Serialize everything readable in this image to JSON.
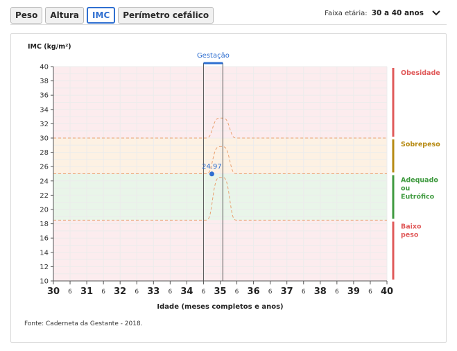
{
  "tabs": [
    {
      "label": "Peso",
      "active": false
    },
    {
      "label": "Altura",
      "active": false
    },
    {
      "label": "IMC",
      "active": true
    },
    {
      "label": "Perímetro cefálico",
      "active": false
    }
  ],
  "age_range": {
    "label": "Faixa etária:",
    "value": "30 a 40 anos",
    "icon": "chevron-down-icon"
  },
  "source": "Fonte: Caderneta da Gestante - 2018.",
  "colors": {
    "accent": "#2f6fd0",
    "obesidade": "#e05a5a",
    "sobrepeso": "#b68a12",
    "adequado": "#3f9a3f",
    "baixo": "#e05a5a"
  },
  "chart_data": {
    "type": "line",
    "ylabel": "IMC (kg/m²)",
    "xlabel": "Idade (meses completos e anos)",
    "ylim": [
      10,
      40
    ],
    "y_ticks": [
      10,
      12,
      14,
      16,
      18,
      20,
      22,
      24,
      26,
      28,
      30,
      32,
      34,
      36,
      38,
      40
    ],
    "xlim": [
      30,
      40
    ],
    "x_major_ticks": [
      30,
      31,
      32,
      33,
      34,
      35,
      36,
      37,
      38,
      39,
      40
    ],
    "x_minor_label": "6",
    "grid": true,
    "gestation": {
      "label": "Gestação",
      "start": 34.5,
      "end": 35.08
    },
    "zones": [
      {
        "name": "Obesidade",
        "from": 30,
        "to": 40,
        "color": "#fcecee",
        "label_color": "#e05a5a"
      },
      {
        "name": "Sobrepeso",
        "from": 25,
        "to": 30,
        "color": "#fdf1e3",
        "label_color": "#b68a12"
      },
      {
        "name": "Adequado ou Eutrófico",
        "from": 18.5,
        "to": 25,
        "color": "#e9f5e9",
        "label_color": "#3f9a3f"
      },
      {
        "name": "Baixo peso",
        "from": 10,
        "to": 18.5,
        "color": "#fcecee",
        "label_color": "#e05a5a"
      }
    ],
    "zone_label_lines": [
      [
        "Obesidade"
      ],
      [
        "Sobrepeso"
      ],
      [
        "Adequado",
        "ou",
        "Eutrófico"
      ],
      [
        "Baixo",
        "peso"
      ]
    ],
    "point": {
      "x": 34.75,
      "y": 24.97,
      "label": "24.97",
      "color": "#2f6fd0"
    }
  }
}
